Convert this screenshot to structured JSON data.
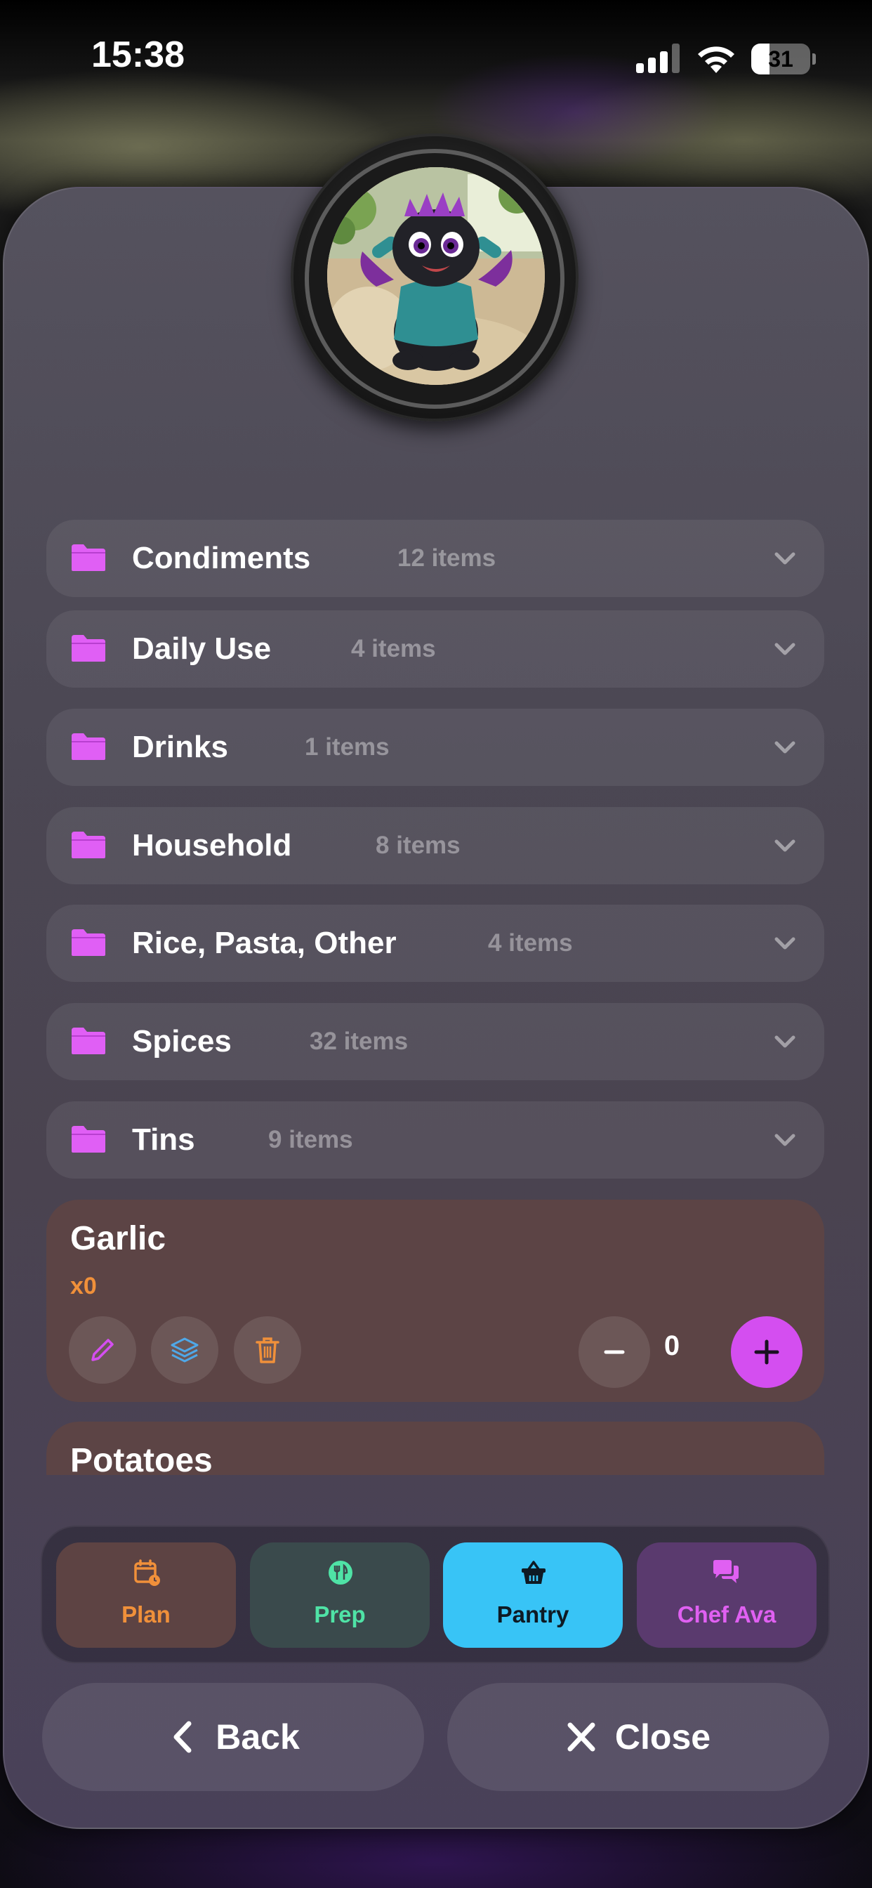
{
  "status_bar": {
    "time": "15:38",
    "battery": "31",
    "battery_level": 0.31
  },
  "categories": [
    {
      "name": "Condiments",
      "count": "12 items"
    },
    {
      "name": "Daily Use",
      "count": "4 items"
    },
    {
      "name": "Drinks",
      "count": "1 items"
    },
    {
      "name": "Household",
      "count": "8 items"
    },
    {
      "name": "Rice, Pasta, Other",
      "count": "4 items"
    },
    {
      "name": "Spices",
      "count": "32 items"
    },
    {
      "name": "Tins",
      "count": "9 items"
    }
  ],
  "items": [
    {
      "name": "Garlic",
      "quantity_label": "x0",
      "stepper_value": "0"
    },
    {
      "name": "Potatoes"
    }
  ],
  "tabs": [
    {
      "label": "Plan",
      "icon": "calendar-icon",
      "color": "#f0903a"
    },
    {
      "label": "Prep",
      "icon": "utensils-icon",
      "color": "#4fe3a6"
    },
    {
      "label": "Pantry",
      "icon": "basket-icon",
      "color": "#38c4f6",
      "selected": true
    },
    {
      "label": "Chef Ava",
      "icon": "chat-bubbles-icon",
      "color": "#e060f2"
    }
  ],
  "buttons": {
    "back": "Back",
    "close": "Close"
  },
  "colors": {
    "accent_pink": "#d44ef0",
    "folder": "#e05ff5",
    "quantity_orange": "#f0903a",
    "layers_blue": "#4fa8e8"
  }
}
